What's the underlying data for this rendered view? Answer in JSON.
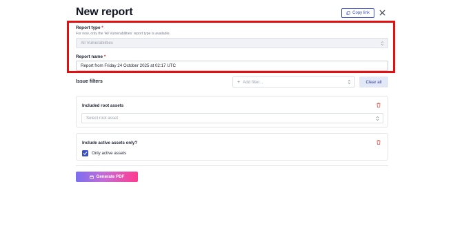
{
  "header": {
    "title": "New report",
    "copy_link_label": "Copy link"
  },
  "report_type": {
    "label": "Report type",
    "required_mark": "*",
    "help": "For now, only the 'All Vulnerabilities' report type is available.",
    "value": "All Vulnerabilities"
  },
  "report_name": {
    "label": "Report name",
    "required_mark": "*",
    "value": "Report from Friday 24 October 2025 at 02:17 UTC"
  },
  "issue_filters": {
    "title": "Issue filters",
    "add_filter_placeholder": "Add filter...",
    "clear_all_label": "Clear all"
  },
  "root_assets": {
    "title": "Included root assets",
    "placeholder": "Select root asset"
  },
  "active_assets": {
    "title": "Include active assets only?",
    "checkbox_label": "Only active assets",
    "checked": true
  },
  "actions": {
    "generate_label": "Generate PDF"
  },
  "colors": {
    "accent": "#3b4fc4",
    "highlight": "#e60f0f",
    "danger": "#e0574f"
  }
}
